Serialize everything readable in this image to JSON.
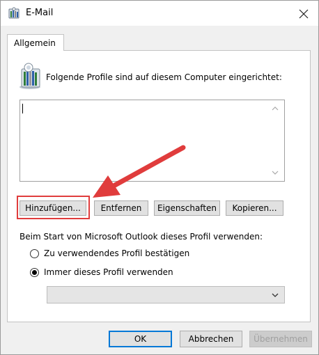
{
  "window": {
    "title": "E-Mail",
    "icon": "mail-profile-icon"
  },
  "tabs": [
    {
      "label": "Allgemein",
      "selected": true
    }
  ],
  "profiles": {
    "intro": "Folgende Profile sind auf diesem Computer eingerichtet:",
    "items": []
  },
  "actions": {
    "add": "Hinzufügen...",
    "remove": "Entfernen",
    "properties": "Eigenschaften",
    "copy": "Kopieren..."
  },
  "startup": {
    "label": "Beim Start von Microsoft Outlook dieses Profil verwenden:",
    "options": [
      {
        "label": "Zu verwendendes Profil bestätigen",
        "selected": false
      },
      {
        "label": "Immer dieses Profil verwenden",
        "selected": true
      }
    ],
    "profile_select_value": ""
  },
  "footer": {
    "ok": "OK",
    "cancel": "Abbrechen",
    "apply": "Übernehmen"
  },
  "annotation": {
    "color": "#e03c3c",
    "target": "Hinzufügen..."
  },
  "colors": {
    "default_button_border": "#0078d7",
    "disabled_text": "#a0a0a0"
  }
}
